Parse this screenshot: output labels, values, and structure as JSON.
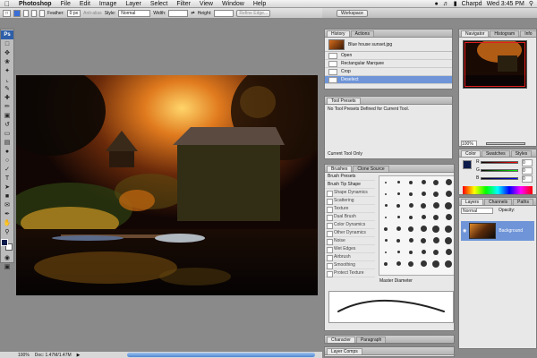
{
  "menubar": {
    "items": [
      "Photoshop",
      "File",
      "Edit",
      "Image",
      "Layer",
      "Select",
      "Filter",
      "View",
      "Window",
      "Help"
    ],
    "user": "Charpd",
    "clock": "Wed 3:45 PM"
  },
  "options": {
    "feather_label": "Feather:",
    "feather_value": "0 px",
    "antialias_label": "Anti-alias",
    "style_label": "Style:",
    "style_value": "Normal",
    "width_label": "Width:",
    "height_label": "Height:",
    "refine_label": "Refine Edge..."
  },
  "workspace": {
    "label": "Workspace"
  },
  "toolbox": {
    "logo": "Ps"
  },
  "history": {
    "tabs": [
      "History",
      "Actions"
    ],
    "snapshot": "Blue house sunset.jpg",
    "steps": [
      "Open",
      "Rectangular Marquee",
      "Crop",
      "Deselect"
    ]
  },
  "tool_presets": {
    "tab": "Tool Presets",
    "message": "No Tool Presets Defined for Current Tool.",
    "footer": "Current Tool Only"
  },
  "brushes": {
    "tabs": [
      "Brushes",
      "Clone Source"
    ],
    "items": [
      "Brush Presets",
      "Brush Tip Shape",
      "Shape Dynamics",
      "Scattering",
      "Texture",
      "Dual Brush",
      "Color Dynamics",
      "Other Dynamics",
      "Noise",
      "Wet Edges",
      "Airbrush",
      "Smoothing",
      "Protect Texture"
    ],
    "master_label": "Master Diameter"
  },
  "navigator": {
    "tabs": [
      "Navigator",
      "Histogram",
      "Info"
    ],
    "zoom": "100%"
  },
  "color": {
    "tabs": [
      "Color",
      "Swatches",
      "Styles"
    ],
    "r_label": "R",
    "g_label": "G",
    "b_label": "B",
    "r_value": "0",
    "g_value": "0",
    "b_value": "0"
  },
  "layers": {
    "tabs": [
      "Layers",
      "Channels",
      "Paths"
    ],
    "mode": "Normal",
    "opacity_label": "Opacity:",
    "layer_name": "Background"
  },
  "bottom_tabs": {
    "character_tabs": [
      "Character",
      "Paragraph"
    ],
    "layer_comps": "Layer Comps"
  },
  "status": {
    "zoom": "100%",
    "doc": "Doc: 1.47M/1.47M"
  },
  "colors": {
    "accent": "#6f95d8",
    "ps_blue": "#2e5fa8"
  }
}
